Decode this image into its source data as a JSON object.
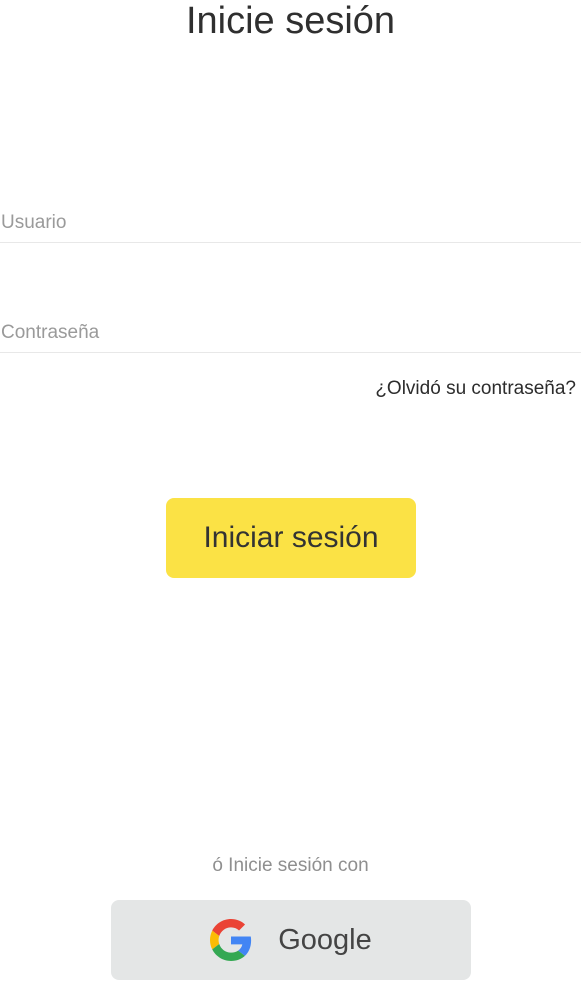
{
  "page": {
    "title": "Inicie sesión"
  },
  "form": {
    "username": {
      "placeholder": "Usuario",
      "value": ""
    },
    "password": {
      "placeholder": "Contraseña",
      "value": ""
    },
    "forgot_link": "¿Olvidó su contraseña?",
    "submit_label": "Iniciar sesión"
  },
  "social": {
    "divider_text": "ó Inicie sesión con",
    "google": {
      "label": "Google",
      "icon": "google-g-icon"
    }
  },
  "colors": {
    "primary_button": "#fbe245",
    "secondary_button": "#e4e6e6",
    "text": "#2f2f2f",
    "placeholder": "#9a9a9a"
  }
}
